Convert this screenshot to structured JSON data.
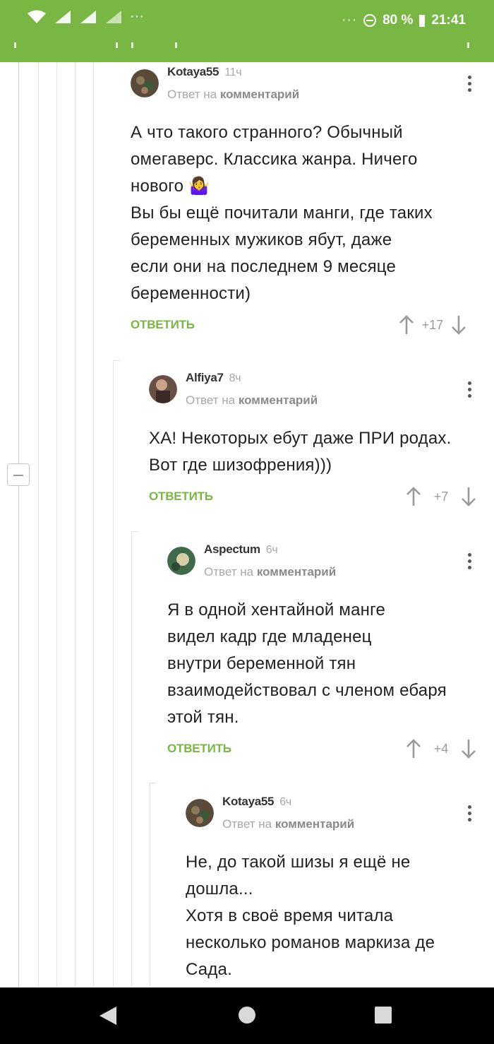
{
  "status_bar": {
    "left_extra": "···",
    "right_dots": "···",
    "battery": "80 %",
    "time": "21:41"
  },
  "comments": [
    {
      "author": "Kotaya55",
      "time": "11ч",
      "reply_prefix": "Ответ на",
      "reply_link": "комментарий",
      "lines": [
        "А что такого странного? Обычный",
        "омегаверс. Классика жанра. Ничего",
        "нового 🤷‍♀️",
        "Вы бы ещё почитали манги, где таких",
        "беременных мужиков ябут, даже",
        "если они на последнем 9 месяце",
        "беременности)"
      ],
      "reply_label": "ОТВЕТИТЬ",
      "score": "+17",
      "avatar_color": "#5a4a3a"
    },
    {
      "author": "Alfiya7",
      "time": "8ч",
      "reply_prefix": "Ответ на",
      "reply_link": "комментарий",
      "lines": [
        "ХА! Некоторых ебут даже ПРИ родах.",
        "Вот где шизофрения)))"
      ],
      "reply_label": "ОТВЕТИТЬ",
      "score": "+7",
      "avatar_color": "#6a4f44"
    },
    {
      "author": "Aspectum",
      "time": "6ч",
      "reply_prefix": "Ответ на",
      "reply_link": "комментарий",
      "lines": [
        "Я в одной хентайной манге",
        "видел кадр где младенец",
        "внутри беременной тян",
        "взаимодействовал с членом ебаря",
        "этой тян."
      ],
      "reply_label": "ОТВЕТИТЬ",
      "score": "+4",
      "avatar_color": "#3f6b4a"
    },
    {
      "author": "Kotaya55",
      "time": "6ч",
      "reply_prefix": "Ответ на",
      "reply_link": "комментарий",
      "lines": [
        "Не, до такой шизы я ещё не",
        "дошла...",
        "Хотя в своё время читала",
        "несколько романов маркиза де",
        "Сада."
      ],
      "avatar_color": "#5a4a3a"
    }
  ],
  "icons": {
    "upvote": "arrow-up-icon",
    "downvote": "arrow-down-icon",
    "menu": "more-vertical-icon",
    "collapse": "minus-icon"
  },
  "colors": {
    "brand_green": "#78b743",
    "meta_grey": "#a8a8a8"
  }
}
